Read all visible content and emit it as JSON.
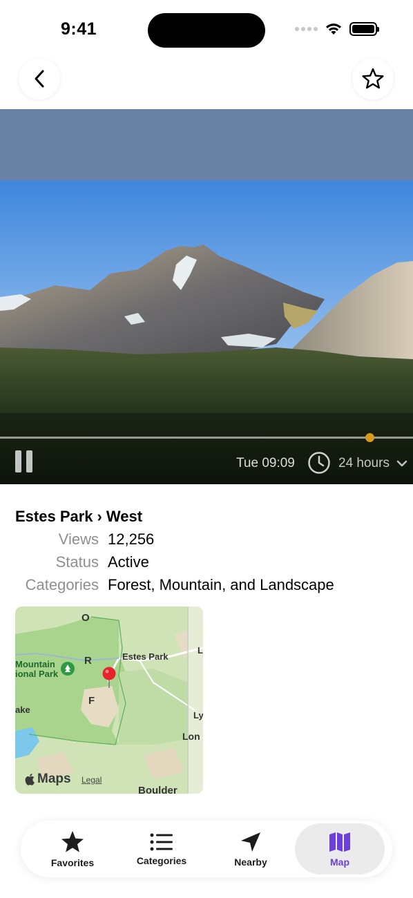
{
  "status_bar": {
    "time": "9:41"
  },
  "webcam": {
    "timestamp": "Tue 09:09",
    "time_range": "24 hours",
    "scrubber_progress": 0.895
  },
  "location": {
    "parent": "Estes Park",
    "separator": "›",
    "name": "West"
  },
  "details": [
    {
      "label": "Views",
      "value": "12,256"
    },
    {
      "label": "Status",
      "value": "Active"
    },
    {
      "label": "Categories",
      "value": "Forest, Mountain, and Landscape"
    }
  ],
  "map": {
    "brand": "Maps",
    "legal": "Legal",
    "labels": {
      "estes_park": "Estes Park",
      "mountain": "Mountain",
      "national_park": "ional Park",
      "lake": "ake",
      "lyons": "Ly",
      "longmont": "Lon",
      "boulder": "Boulder",
      "road_o": "O",
      "road_r": "R",
      "road_f": "F",
      "edge_l": "L"
    }
  },
  "tab_bar": {
    "tabs": [
      {
        "label": "Favorites",
        "icon": "star-fill-icon"
      },
      {
        "label": "Categories",
        "icon": "list-icon"
      },
      {
        "label": "Nearby",
        "icon": "location-arrow-icon"
      },
      {
        "label": "Map",
        "icon": "map-icon",
        "active": true
      }
    ],
    "accent_color": "#6c3fd9"
  }
}
